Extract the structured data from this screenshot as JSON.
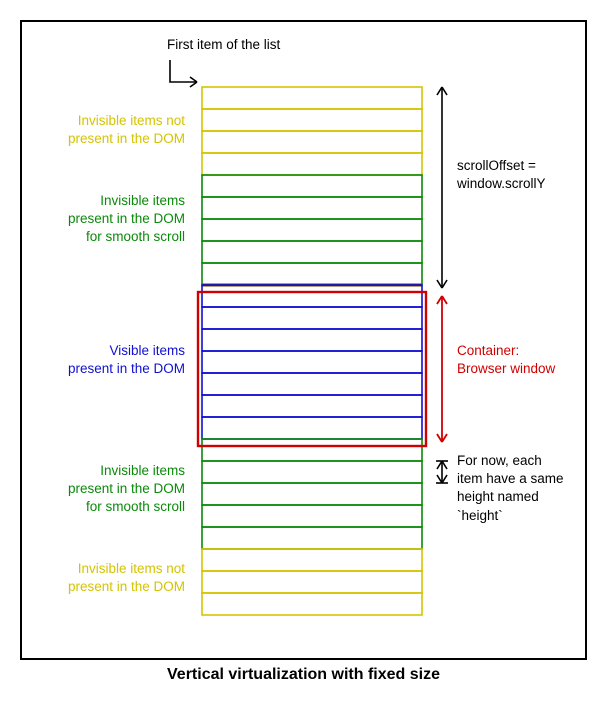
{
  "title_label": "First item of the list",
  "caption": "Vertical virtualization with fixed size",
  "labels": {
    "top_yellow": "Invisible items not\npresent in the DOM",
    "top_green": "Invisible items\npresent in the DOM\nfor smooth scroll",
    "middle_blue": "Visible items\npresent in the DOM",
    "bottom_green": "Invisible items\npresent in the DOM\nfor smooth scroll",
    "bottom_yellow": "Invisible items not\npresent in the DOM",
    "scroll_label": "scrollOffset =\nwindow.scrollY",
    "container_label": "Container:\nBrowser window",
    "height_label": "For now, each\nitem have a same\nheight named\n`height`"
  },
  "colors": {
    "yellow": "#d4c400",
    "green": "#0a8a0a",
    "blue": "#1010d0",
    "red": "#d00000",
    "brown": "#6b3b00",
    "black": "#000000"
  },
  "chart_data": {
    "type": "table",
    "description": "Schematic of a vertically virtualized list with fixed item height.",
    "item_height_symbol": "height",
    "sections": [
      {
        "zone": "invisible_not_in_dom_top",
        "label": "Invisible items not present in the DOM",
        "color": "yellow",
        "item_count": 4
      },
      {
        "zone": "invisible_in_dom_top",
        "label": "Invisible items present in the DOM for smooth scroll",
        "color": "green",
        "item_count": 5
      },
      {
        "zone": "visible_in_dom",
        "label": "Visible items present in the DOM",
        "color": "blue",
        "item_count": 7
      },
      {
        "zone": "invisible_in_dom_bottom",
        "label": "Invisible items present in the DOM for smooth scroll",
        "color": "green",
        "item_count": 5
      },
      {
        "zone": "invisible_not_in_dom_bottom",
        "label": "Invisible items not present in the DOM",
        "color": "yellow",
        "item_count": 3
      }
    ],
    "viewport": {
      "name": "Browser window",
      "color": "red",
      "start_item_index": 9,
      "end_item_index_exclusive": 16,
      "start_offset_fraction": 0.333
    },
    "annotations": {
      "scroll_offset": "scrollOffset = window.scrollY (distance from top of list to top of viewport)",
      "item_height": "Each item has the same height, referred to as `height`"
    },
    "first_item_note": "First item of the list (topmost yellow row)"
  }
}
